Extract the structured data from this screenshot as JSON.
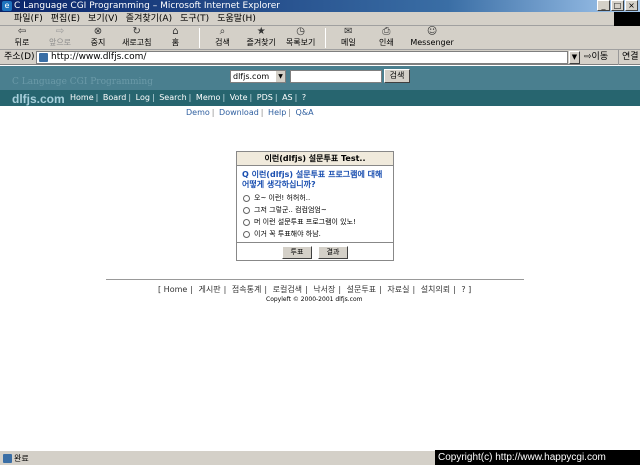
{
  "window": {
    "title": "C Language CGI Programming – Microsoft Internet Explorer",
    "buttons": [
      "_",
      "□",
      "×"
    ]
  },
  "menu": [
    "파일(F)",
    "편집(E)",
    "보기(V)",
    "즐겨찾기(A)",
    "도구(T)",
    "도움말(H)"
  ],
  "toolbar": {
    "back": "뒤로",
    "forward": "앞으로",
    "stop": "중지",
    "refresh": "새로고침",
    "home": "홈",
    "search": "검색",
    "favorites": "즐겨찾기",
    "history": "목록보기",
    "mail": "메일",
    "print": "인쇄",
    "messenger": "Messenger"
  },
  "address": {
    "label": "주소(D)",
    "url": "http://www.dlfjs.com/",
    "go": "이동",
    "links": "연결"
  },
  "site": {
    "banner_title": "C Language CGI Programming",
    "search_select": "dlfjs.com",
    "search_button": "검색",
    "logo": "dlfjs.com",
    "nav": [
      "Home",
      "Board",
      "Log",
      "Search",
      "Memo",
      "Vote",
      "PDS",
      "AS",
      "?"
    ],
    "subnav": [
      "Demo",
      "Download",
      "Help",
      "Q&A"
    ]
  },
  "poll": {
    "header": "이런(dlfjs) 설문투표 Test..",
    "question": "Q 이런(dlfjs) 설문투표 프로그램에 대해 어떻게 생각하십니까?",
    "options": [
      "오~ 이런! 허허허..",
      "그저 그렇군.. 컴컴엄엄~",
      "머 이런 설문투표 프로그램이 있노!",
      "이거 꼭 투표해야 하남."
    ],
    "vote_button": "투표",
    "result_button": "결과"
  },
  "footer": {
    "links": [
      "Home",
      "게시판",
      "접속통계",
      "로컬검색",
      "낙서장",
      "설문투표",
      "자료실",
      "설치의뢰",
      "?"
    ],
    "copyright": "Copyleft © 2000-2001 dlfjs.com"
  },
  "status": {
    "text": "완료",
    "watermark": "Copyright(c) http://www.happycgi.com"
  }
}
